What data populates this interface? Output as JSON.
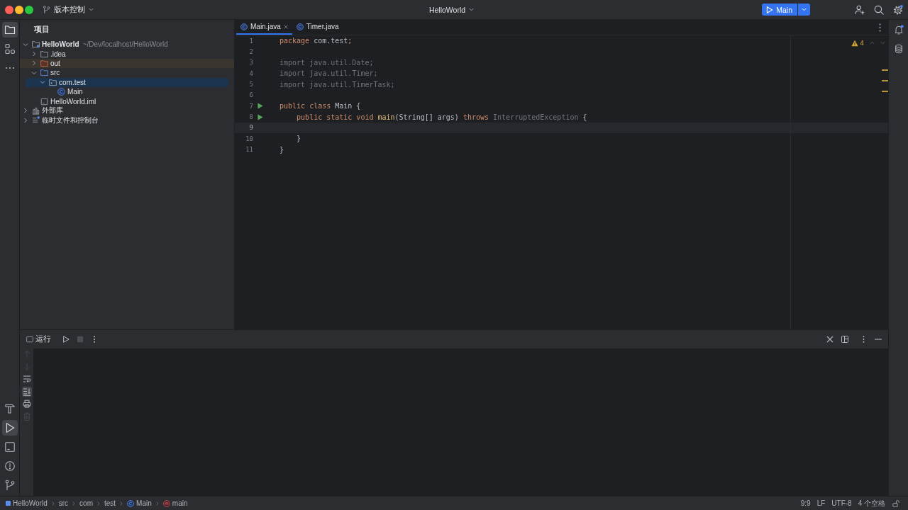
{
  "title_bar": {
    "vcs_widget": "版本控制",
    "project": "HelloWorld",
    "run_config": "Main",
    "settings_badge": true
  },
  "left_toolbar": {
    "top": [
      {
        "kind": "project",
        "selected": true
      },
      {
        "kind": "structure",
        "selected": false
      },
      {
        "kind": "more",
        "selected": false
      }
    ],
    "bottom": [
      {
        "kind": "build",
        "selected": false
      },
      {
        "kind": "run",
        "selected": true
      },
      {
        "kind": "terminal",
        "selected": false
      },
      {
        "kind": "problems",
        "selected": false
      },
      {
        "kind": "git",
        "selected": false
      }
    ]
  },
  "project_panel": {
    "title": "项目",
    "tree": [
      {
        "label": "HelloWorld",
        "path": "~/Dev/localhost/HelloWorld",
        "kind": "module",
        "expanded": true,
        "selected": false,
        "children": [
          {
            "label": ".idea",
            "kind": "folder",
            "expanded": false,
            "selected": false
          },
          {
            "label": "out",
            "kind": "excluded",
            "expanded": false,
            "selected": false
          },
          {
            "label": "src",
            "kind": "source",
            "expanded": true,
            "selected": false,
            "children": [
              {
                "label": "com.test",
                "kind": "package",
                "expanded": true,
                "selected": true,
                "children": [
                  {
                    "label": "Main",
                    "kind": "class",
                    "selected": false
                  }
                ]
              }
            ]
          },
          {
            "label": "HelloWorld.iml",
            "kind": "file",
            "selected": false
          }
        ]
      },
      {
        "label": "外部库",
        "kind": "libraries",
        "expanded": false,
        "selected": false
      },
      {
        "label": "临时文件和控制台",
        "kind": "scratches",
        "expanded": false,
        "selected": false
      }
    ]
  },
  "editor": {
    "tabs": [
      {
        "label": "Main.java",
        "selected": true
      },
      {
        "label": "Timer.java",
        "selected": false
      }
    ],
    "warnings": "4",
    "lines": [
      {
        "number": "1",
        "run_marker": false,
        "current": false,
        "tokens": [
          {
            "text": "package",
            "kind": "keyword"
          },
          {
            "text": " com.test",
            "kind": "plain"
          },
          {
            "text": ";",
            "kind": "keyword"
          }
        ]
      },
      {
        "number": "2",
        "run_marker": false,
        "current": false
      },
      {
        "number": "3",
        "run_marker": false,
        "current": false,
        "tokens": [
          {
            "text": "import java.util.Date;",
            "kind": "unused"
          }
        ]
      },
      {
        "number": "4",
        "run_marker": false,
        "current": false,
        "tokens": [
          {
            "text": "import java.util.Timer;",
            "kind": "unused"
          }
        ]
      },
      {
        "number": "5",
        "run_marker": false,
        "current": false,
        "tokens": [
          {
            "text": "import java.util.TimerTask;",
            "kind": "unused"
          }
        ]
      },
      {
        "number": "6",
        "run_marker": false,
        "current": false
      },
      {
        "number": "7",
        "run_marker": true,
        "current": false,
        "tokens": [
          {
            "text": "public class",
            "kind": "keyword"
          },
          {
            "text": " Main {",
            "kind": "plain"
          }
        ]
      },
      {
        "number": "8",
        "run_marker": true,
        "current": false,
        "tokens": [
          {
            "text": "    public static void ",
            "kind": "keyword"
          },
          {
            "text": "main",
            "kind": "method"
          },
          {
            "text": "(String[] args) ",
            "kind": "plain"
          },
          {
            "text": "throws",
            "kind": "keyword"
          },
          {
            "text": " InterruptedException",
            "kind": "dim"
          },
          {
            "text": " {",
            "kind": "plain"
          }
        ]
      },
      {
        "number": "9",
        "run_marker": false,
        "current": true
      },
      {
        "number": "10",
        "run_marker": false,
        "current": false,
        "tokens": [
          {
            "text": "    }",
            "kind": "plain"
          }
        ]
      },
      {
        "number": "11",
        "run_marker": false,
        "current": false,
        "tokens": [
          {
            "text": "}",
            "kind": "plain"
          }
        ]
      }
    ]
  },
  "right_toolbar": [
    {
      "kind": "notifications",
      "badge": true
    },
    {
      "kind": "database",
      "badge": false
    }
  ],
  "run_panel": {
    "title": "运行",
    "actions": [
      {
        "kind": "rerun",
        "disabled": false
      },
      {
        "kind": "stop",
        "disabled": true
      },
      {
        "kind": "more",
        "disabled": false
      }
    ],
    "console_tools": [
      {
        "kind": "up",
        "disabled": true,
        "on": false
      },
      {
        "kind": "down",
        "disabled": true,
        "on": false
      },
      {
        "kind": "soft-wrap",
        "disabled": false,
        "on": false
      },
      {
        "kind": "scroll-end",
        "disabled": false,
        "on": true
      },
      {
        "kind": "print",
        "disabled": false,
        "on": false
      },
      {
        "kind": "clear",
        "disabled": true,
        "on": false
      }
    ]
  },
  "status_bar": {
    "breadcrumbs": [
      {
        "label": "HelloWorld",
        "kind": "module"
      },
      {
        "label": "src",
        "kind": "folder"
      },
      {
        "label": "com",
        "kind": "folder"
      },
      {
        "label": "test",
        "kind": "folder"
      },
      {
        "label": "Main",
        "kind": "class"
      },
      {
        "label": "main",
        "kind": "method"
      }
    ],
    "items": [
      "9:9",
      "LF",
      "UTF-8",
      "4 个空格"
    ],
    "read_only": false
  }
}
